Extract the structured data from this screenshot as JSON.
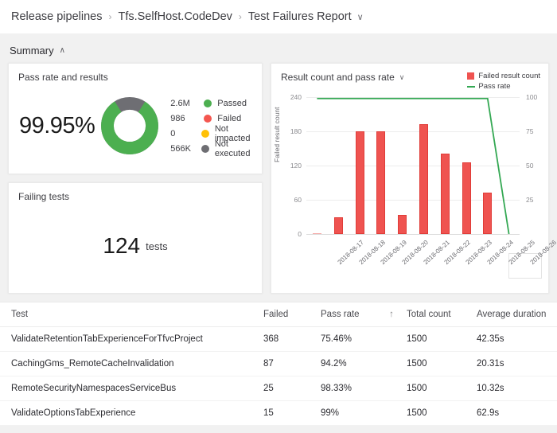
{
  "breadcrumb": {
    "items": [
      "Release pipelines",
      "Tfs.SelfHost.CodeDev",
      "Test Failures Report"
    ],
    "separator": "›",
    "caret": "∨"
  },
  "summary": {
    "label": "Summary",
    "chevron": "∧"
  },
  "pass_rate_card": {
    "title": "Pass rate and results",
    "percent": "99.95%",
    "legend": [
      {
        "value": "2.6M",
        "label": "Passed",
        "color": "#4caf50"
      },
      {
        "value": "986",
        "label": "Failed",
        "color": "#f4564f"
      },
      {
        "value": "0",
        "label": "Not impacted",
        "color": "#ffc107"
      },
      {
        "value": "566K",
        "label": "Not executed",
        "color": "#6e6e73"
      }
    ],
    "donut": {
      "passed_pct": 82,
      "not_executed_pct": 18,
      "passed_color": "#4caf50",
      "not_executed_color": "#6e6e73"
    }
  },
  "failing_tests_card": {
    "title": "Failing tests",
    "count": "124",
    "unit": "tests"
  },
  "chart_data": {
    "type": "bar",
    "title": "Result count and pass rate",
    "caret": "∨",
    "xlabel": "",
    "ylabel": "Failed result count",
    "y2label": "",
    "ylim": [
      0,
      240
    ],
    "yticks": [
      240,
      180,
      120,
      60,
      0
    ],
    "y2lim": [
      0,
      100
    ],
    "y2ticks": [
      100,
      75,
      50,
      25
    ],
    "grid": true,
    "legend_position": "top-right",
    "categories": [
      "2018-08-17",
      "2018-08-18",
      "2018-08-19",
      "2018-08-20",
      "2018-08-21",
      "2018-08-22",
      "2018-08-23",
      "2018-08-24",
      "2018-08-25",
      "2018-08-26"
    ],
    "series": [
      {
        "name": "Failed result count",
        "kind": "bar",
        "axis": "left",
        "color": "#ef5350",
        "values": [
          1,
          30,
          180,
          180,
          33,
          192,
          141,
          126,
          72,
          0
        ]
      },
      {
        "name": "Pass rate",
        "kind": "line",
        "axis": "right",
        "color": "#34a853",
        "values": [
          99,
          99,
          99,
          99,
          99,
          99,
          99,
          99,
          99,
          0
        ]
      }
    ]
  },
  "table": {
    "columns": [
      "Test",
      "Failed",
      "Pass rate",
      "Total count",
      "Average duration"
    ],
    "sort_indicator": "↑",
    "rows": [
      {
        "test": "ValidateRetentionTabExperienceForTfvcProject",
        "failed": "368",
        "pass_rate": "75.46%",
        "total": "1500",
        "duration": "42.35s"
      },
      {
        "test": "CachingGms_RemoteCacheInvalidation",
        "failed": "87",
        "pass_rate": "94.2%",
        "total": "1500",
        "duration": "20.31s"
      },
      {
        "test": "RemoteSecurityNamespacesServiceBus",
        "failed": "25",
        "pass_rate": "98.33%",
        "total": "1500",
        "duration": "10.32s"
      },
      {
        "test": "ValidateOptionsTabExperience",
        "failed": "15",
        "pass_rate": "99%",
        "total": "1500",
        "duration": "62.9s"
      }
    ]
  }
}
